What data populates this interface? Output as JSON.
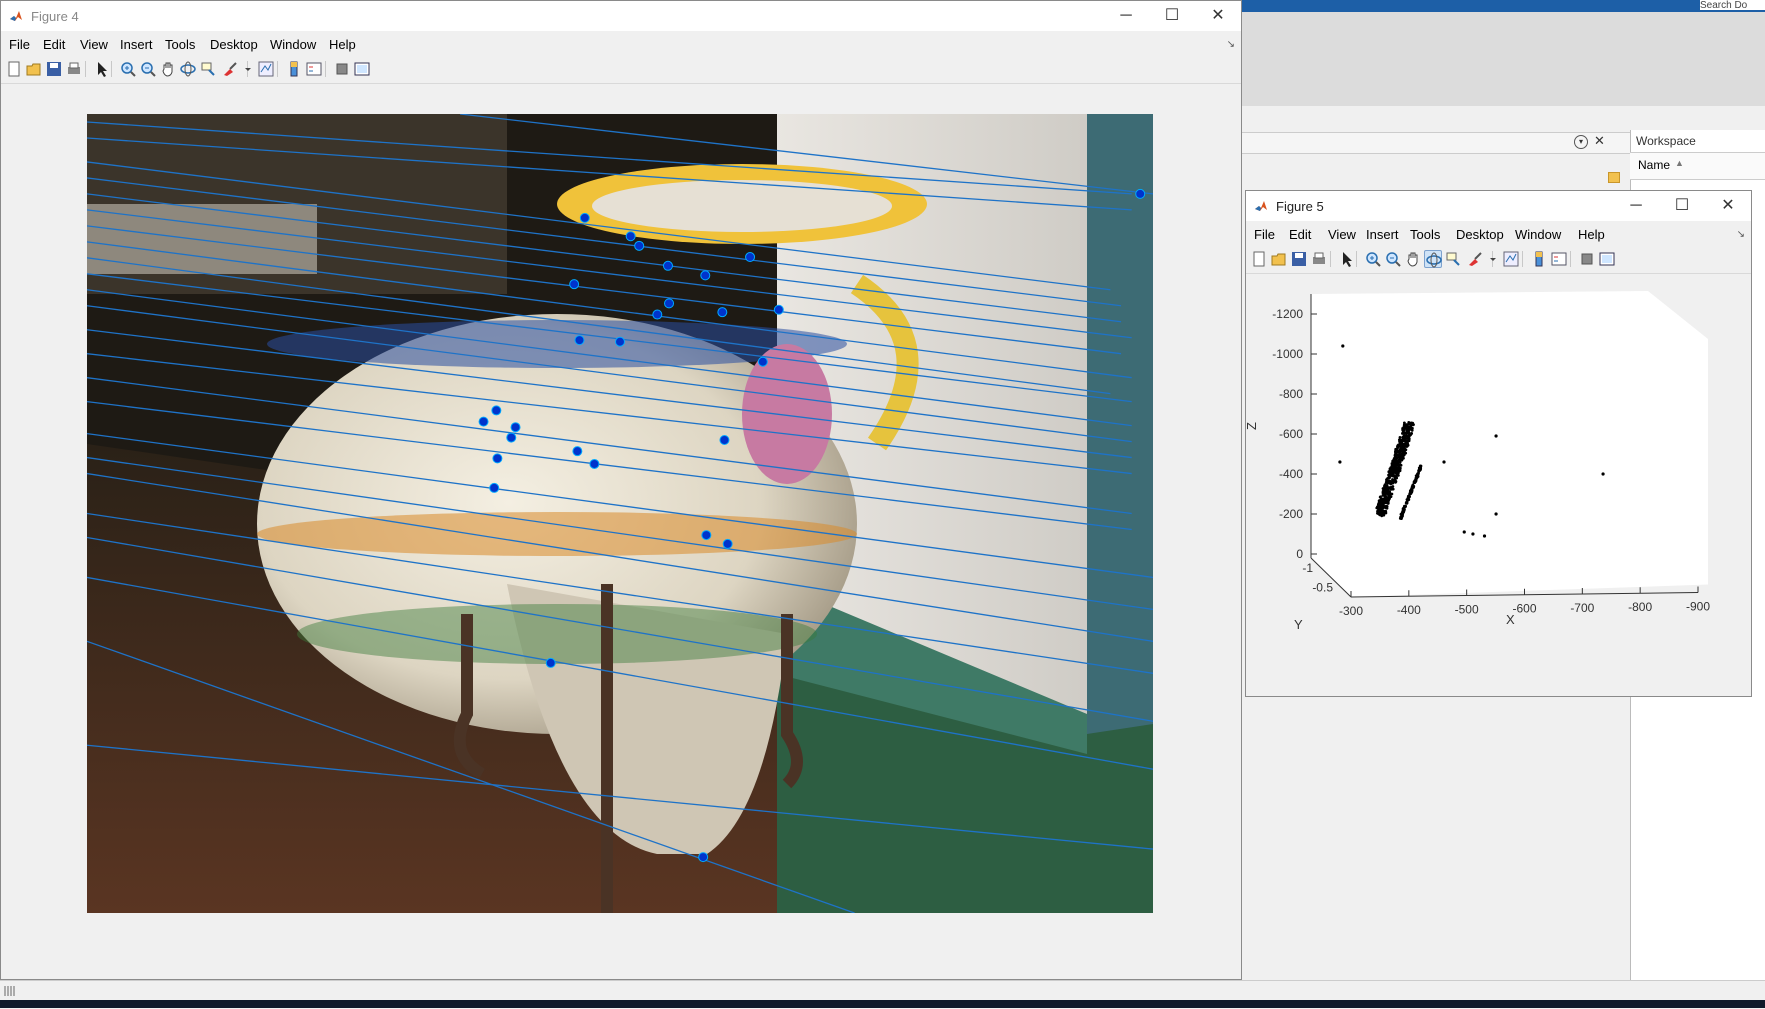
{
  "desktop": {
    "search_label": "Search Do",
    "workspace_title": "Workspace",
    "workspace_column": "Name",
    "sort_indicator": "▲"
  },
  "figure4": {
    "title": "Figure 4",
    "menu": [
      "File",
      "Edit",
      "View",
      "Insert",
      "Tools",
      "Desktop",
      "Window",
      "Help"
    ],
    "toolbar": [
      "new-figure-icon",
      "open-file-icon",
      "save-icon",
      "print-icon",
      "edit-plot-icon",
      "zoom-in-icon",
      "zoom-out-icon",
      "pan-icon",
      "rotate-3d-icon",
      "data-cursor-icon",
      "brush-icon",
      "link-plot-icon",
      "colorbar-icon",
      "legend-icon",
      "hide-plot-tools-icon",
      "show-plot-tools-icon"
    ],
    "feature_points": [
      [
        0.622,
        0.179
      ],
      [
        0.467,
        0.13
      ],
      [
        0.51,
        0.153
      ],
      [
        0.518,
        0.165
      ],
      [
        0.545,
        0.19
      ],
      [
        0.58,
        0.202
      ],
      [
        0.457,
        0.213
      ],
      [
        0.546,
        0.237
      ],
      [
        0.596,
        0.248
      ],
      [
        0.649,
        0.245
      ],
      [
        0.535,
        0.251
      ],
      [
        0.462,
        0.283
      ],
      [
        0.5,
        0.285
      ],
      [
        0.634,
        0.31
      ],
      [
        0.384,
        0.371
      ],
      [
        0.402,
        0.392
      ],
      [
        0.398,
        0.405
      ],
      [
        0.372,
        0.385
      ],
      [
        0.385,
        0.431
      ],
      [
        0.46,
        0.422
      ],
      [
        0.476,
        0.438
      ],
      [
        0.598,
        0.408
      ],
      [
        0.382,
        0.468
      ],
      [
        0.581,
        0.527
      ],
      [
        0.601,
        0.538
      ],
      [
        0.435,
        0.687
      ],
      [
        0.578,
        0.93
      ],
      [
        0.988,
        0.1
      ]
    ],
    "epipolar_lines": [
      [
        0.0,
        0.01,
        0.98,
        0.1
      ],
      [
        0.0,
        0.03,
        0.98,
        0.12
      ],
      [
        0.0,
        0.06,
        0.96,
        0.22
      ],
      [
        0.0,
        0.08,
        0.97,
        0.24
      ],
      [
        0.0,
        0.1,
        0.97,
        0.26
      ],
      [
        0.0,
        0.12,
        0.98,
        0.28
      ],
      [
        0.0,
        0.14,
        0.97,
        0.3
      ],
      [
        0.0,
        0.16,
        0.98,
        0.33
      ],
      [
        0.0,
        0.18,
        0.96,
        0.35
      ],
      [
        0.0,
        0.2,
        0.98,
        0.36
      ],
      [
        0.0,
        0.22,
        0.98,
        0.39
      ],
      [
        0.0,
        0.24,
        0.98,
        0.41
      ],
      [
        0.0,
        0.27,
        0.98,
        0.43
      ],
      [
        0.0,
        0.3,
        0.98,
        0.45
      ],
      [
        0.0,
        0.33,
        0.98,
        0.5
      ],
      [
        0.0,
        0.36,
        0.98,
        0.52
      ],
      [
        0.0,
        0.4,
        1.0,
        0.58
      ],
      [
        0.0,
        0.43,
        1.0,
        0.62
      ],
      [
        0.0,
        0.45,
        1.0,
        0.66
      ],
      [
        0.0,
        0.5,
        1.0,
        0.7
      ],
      [
        0.0,
        0.53,
        1.0,
        0.76
      ],
      [
        0.0,
        0.58,
        1.0,
        0.82
      ],
      [
        0.0,
        0.66,
        0.72,
        1.0
      ],
      [
        0.0,
        0.79,
        1.0,
        0.92
      ],
      [
        0.35,
        0.0,
        1.0,
        0.1
      ]
    ],
    "colors": {
      "epipolar_line": "#1e73c8",
      "feature_point": "#0033cc",
      "figure_bg": "#f0f0f0"
    }
  },
  "figure5": {
    "title": "Figure 5",
    "menu": [
      "File",
      "Edit",
      "View",
      "Insert",
      "Tools",
      "Desktop",
      "Window",
      "Help"
    ],
    "toolbar": [
      "new-figure-icon",
      "open-file-icon",
      "save-icon",
      "print-icon",
      "edit-plot-icon",
      "zoom-in-icon",
      "zoom-out-icon",
      "pan-icon",
      "rotate-3d-icon",
      "data-cursor-icon",
      "brush-icon",
      "link-plot-icon",
      "colorbar-icon",
      "legend-icon",
      "hide-plot-tools-icon",
      "show-plot-tools-icon"
    ],
    "active_tool": "rotate-3d-icon"
  },
  "chart_data": {
    "type": "scatter",
    "title": "",
    "xlabel": "X",
    "ylabel": "Y",
    "zlabel": "Z",
    "xlim": [
      -300,
      -900
    ],
    "ylim": [
      -1,
      -0.5
    ],
    "zlim": [
      -1300,
      0
    ],
    "x_ticks": [
      "-300",
      "-400",
      "-500",
      "-600",
      "-700",
      "-800",
      "-900"
    ],
    "y_ticks": [
      "-1",
      "-0.5"
    ],
    "z_ticks": [
      "0",
      "-200",
      "-400",
      "-600",
      "-800",
      "-1000",
      "-1200"
    ],
    "grid": false,
    "view": "3-D scatter, rotated view",
    "marker_color": "#000000",
    "clusters": [
      {
        "description": "dense elongated cluster",
        "x_range": [
          -420,
          -470
        ],
        "z_range": [
          -200,
          -650
        ],
        "count": 600
      },
      {
        "description": "thin parallel streak",
        "x_range": [
          -455,
          -490
        ],
        "z_range": [
          -180,
          -440
        ],
        "count": 120
      }
    ],
    "outliers": [
      {
        "x": -350,
        "z": -460
      },
      {
        "x": -355,
        "z": -1040
      },
      {
        "x": -620,
        "z": -590
      },
      {
        "x": -805,
        "z": -400
      },
      {
        "x": -580,
        "z": -100
      },
      {
        "x": -565,
        "z": -110
      },
      {
        "x": -600,
        "z": -90
      },
      {
        "x": -620,
        "z": -200
      },
      {
        "x": -530,
        "z": -460
      }
    ]
  }
}
